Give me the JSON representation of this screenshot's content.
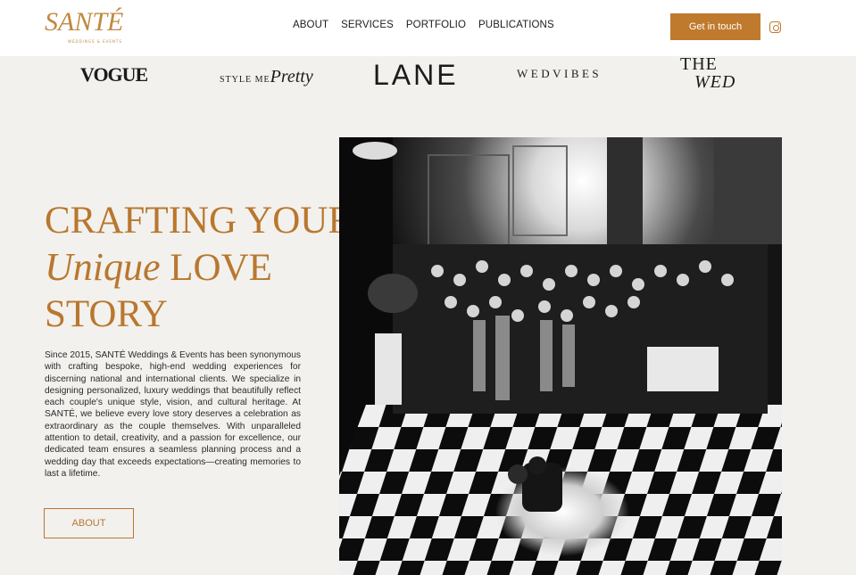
{
  "header": {
    "logo_text": "SANTÉ",
    "logo_subtext": "WEDDINGS & EVENTS",
    "nav": [
      "ABOUT",
      "SERVICES",
      "PORTFOLIO",
      "PUBLICATIONS"
    ],
    "cta_label": "Get in touch",
    "social_icon": "instagram-icon"
  },
  "publications": {
    "vogue": "VOGUE",
    "style_me_pretty_a": "STYLE ME",
    "style_me_pretty_b": "Pretty",
    "lane": "LANE",
    "wedvibes": "WEDVIBES",
    "the_wed_a": "THE",
    "the_wed_b": "WED"
  },
  "hero": {
    "title_line1": "CRAFTING YOUR",
    "title_script": "Unique",
    "title_line2_rest": " LOVE",
    "title_line3": "STORY",
    "body": "Since 2015, SANTÉ Weddings & Events has been synonymous with crafting bespoke, high-end wedding experiences for discerning national and international clients. We specialize in designing personalized, luxury weddings that beautifully reflect each couple's unique style, vision, and cultural heritage. At SANTÉ, we believe every love story deserves a celebration as extraordinary as the couple themselves. With unparalleled attention to detail, creativity, and a passion for excellence, our dedicated team ensures a seamless planning process and a wedding day that exceeds expectations—creating memories to last a lifetime.",
    "button_label": "ABOUT"
  },
  "colors": {
    "accent": "#bf7a2e",
    "background": "#f2f1ee",
    "header_bg": "#ffffff"
  }
}
